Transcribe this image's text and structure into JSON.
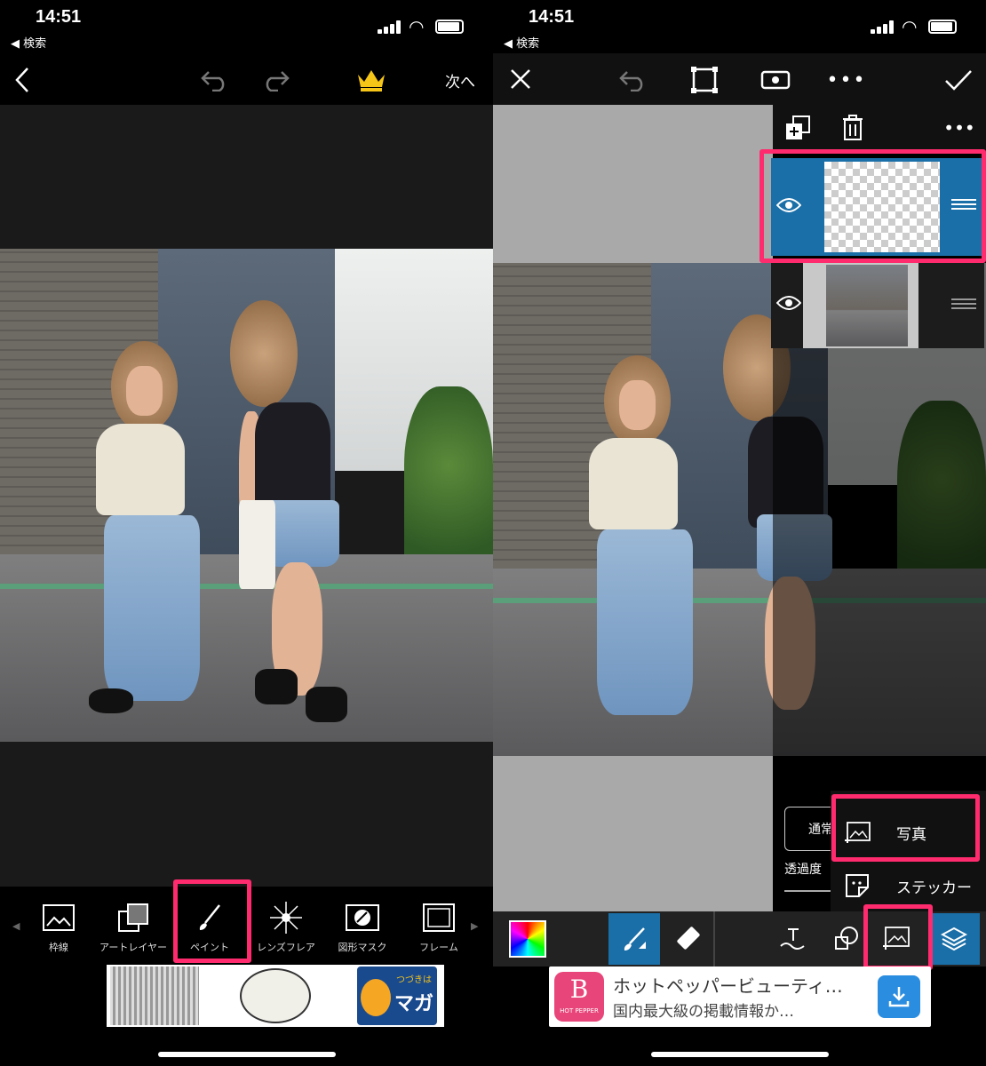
{
  "left": {
    "status": {
      "time": "14:51",
      "back_label": "◀ 検索"
    },
    "top": {
      "next_label": "次へ"
    },
    "tools": [
      {
        "label": "枠線",
        "icon": "image-icon"
      },
      {
        "label": "アートレイヤー",
        "icon": "art-layer-icon"
      },
      {
        "label": "ペイント",
        "icon": "brush-icon"
      },
      {
        "label": "レンズフレア",
        "icon": "lens-flare-icon"
      },
      {
        "label": "図形マスク",
        "icon": "shape-mask-icon"
      },
      {
        "label": "フレーム",
        "icon": "frame-icon"
      }
    ],
    "ad": {
      "text1": "つづきは",
      "text2": "マガ"
    }
  },
  "right": {
    "status": {
      "time": "14:51",
      "back_label": "◀ 検索"
    },
    "panel": {
      "blend_label": "通常",
      "opacity_label": "透過度"
    },
    "menu": {
      "photo_label": "写真",
      "sticker_label": "ステッカー"
    },
    "ad": {
      "title": "ホットペッパービューティ…",
      "subtitle": "国内最大級の掲載情報か…",
      "logo_text": "B",
      "logo_sub": "HOT PEPPER"
    }
  },
  "colors": {
    "highlight": "#ff2b6e",
    "accent_blue": "#1a6fa8",
    "crown": "#f5c518"
  }
}
